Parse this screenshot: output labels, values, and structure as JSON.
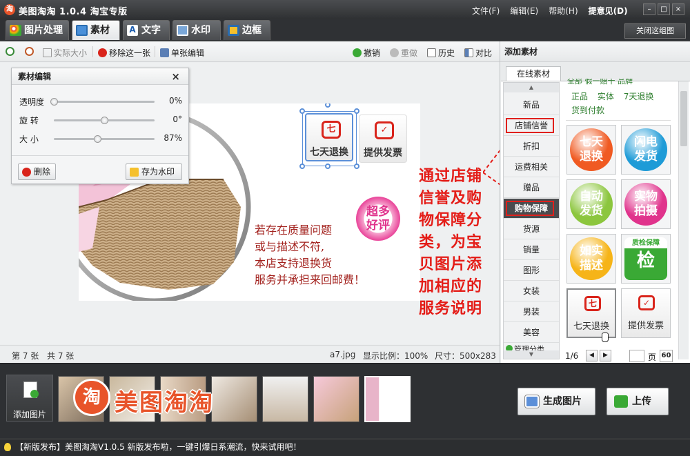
{
  "app": {
    "title": "美图淘淘 1.0.4 淘宝专版",
    "logo_char": "淘"
  },
  "menu": [
    "文件(F)",
    "编辑(E)",
    "帮助(H)",
    "提意见(D)"
  ],
  "window_controls": [
    "–",
    "□",
    "×"
  ],
  "tabs": [
    "图片处理",
    "素材",
    "文字",
    "水印",
    "边框"
  ],
  "close_group": "关闭这组图",
  "toolbar": {
    "actual_size": "实际大小",
    "remove_this": "移除这一张",
    "single_edit": "单张编辑",
    "undo": "撤销",
    "redo": "重做",
    "history": "历史",
    "compare": "对比"
  },
  "editor": {
    "title": "素材编辑",
    "close": "×",
    "sliders": [
      {
        "label": "透明度",
        "value": "0%",
        "level": 0
      },
      {
        "label": "旋 转",
        "value": "0°",
        "level": 0.5
      },
      {
        "label": "大 小",
        "value": "87%",
        "level": 0.43
      }
    ],
    "delete": "删除",
    "save_watermark": "存为水印"
  },
  "photo": {
    "badge1": "七天退换",
    "badge1_symbol": "七",
    "badge2": "提供发票",
    "badge2_symbol": "✓",
    "round_badge": [
      "超多",
      "好评"
    ],
    "text_lines": [
      "若存在质量问题",
      "或与描述不符,",
      "本店支持退换货",
      "服务并承担来回邮费！"
    ]
  },
  "status": {
    "index": "第 7 张",
    "total": "共 7 张",
    "file": "a7.jpg",
    "ratio": "显示比例：100%",
    "size": "尺寸：500x283"
  },
  "right": {
    "title": "添加素材",
    "tab": "在线素材",
    "categories": [
      "新品",
      "店铺信誉",
      "折扣",
      "运费相关",
      "赠品",
      "购物保障",
      "货源",
      "销量",
      "图形",
      "女装",
      "男装",
      "美容"
    ],
    "manage": "管理分类",
    "tags_top": "全部   假一赔十   品牌",
    "tags": [
      "正品",
      "实体",
      "7天退换"
    ],
    "tags2": [
      "货到付款"
    ],
    "materials": [
      {
        "line1": "七天",
        "line2": "退换",
        "color": "#f05a22"
      },
      {
        "line1": "闪电",
        "line2": "发货",
        "color": "#1e9bd7"
      },
      {
        "line1": "自动",
        "line2": "发货",
        "color": "#8cc63e"
      },
      {
        "line1": "实物",
        "line2": "拍摄",
        "color": "#e0338c"
      },
      {
        "line1": "如实",
        "line2": "描述",
        "color": "#f6b418"
      },
      {
        "line1": "质检保障",
        "line2": "检",
        "color": "#3aa935"
      },
      {
        "line1": "七天退换",
        "line2": "七",
        "color": "#d9241b"
      },
      {
        "line1": "提供发票",
        "line2": "✓",
        "color": "#d9241b"
      }
    ],
    "pager": {
      "page": "1/6",
      "label": "页",
      "per_page": "60"
    }
  },
  "annotation": "通过店铺信誉及购物保障分类，为宝贝图片添加相应的服务说明",
  "bottom": {
    "add_picture": "添加图片",
    "watermark_logo": "美图淘淘",
    "generate": "生成图片",
    "upload": "上传"
  },
  "news": "【新版发布】美图淘淘V1.0.5 新版发布啦，一键引爆日系潮流，快来试用吧！"
}
